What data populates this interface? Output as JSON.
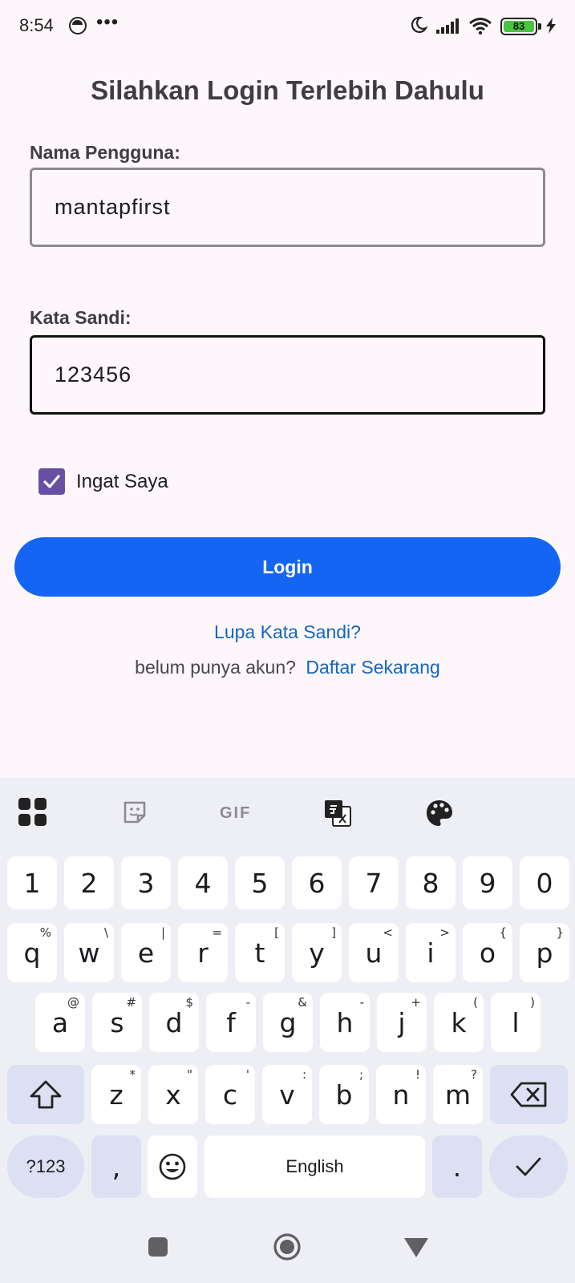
{
  "status_bar": {
    "time": "8:54",
    "more": "•••",
    "battery": "83"
  },
  "form": {
    "title": "Silahkan Login Terlebih Dahulu",
    "username_label": "Nama Pengguna:",
    "username_value": "mantapfirst",
    "password_label": "Kata Sandi:",
    "password_value": "123456",
    "remember_label": "Ingat Saya",
    "remember_checked": true,
    "login_label": "Login",
    "forgot_label": "Lupa Kata Sandi?",
    "register_prompt": "belum punya akun?",
    "register_link": "Daftar Sekarang",
    "accent_color": "#1565f4",
    "checkbox_color": "#6750a4"
  },
  "keyboard": {
    "toolbar": {
      "gif_label": "GIF"
    },
    "row_numbers": [
      "1",
      "2",
      "3",
      "4",
      "5",
      "6",
      "7",
      "8",
      "9",
      "0"
    ],
    "row1": [
      {
        "k": "q",
        "s": "%"
      },
      {
        "k": "w",
        "s": "\\"
      },
      {
        "k": "e",
        "s": "|"
      },
      {
        "k": "r",
        "s": "="
      },
      {
        "k": "t",
        "s": "["
      },
      {
        "k": "y",
        "s": "]"
      },
      {
        "k": "u",
        "s": "<"
      },
      {
        "k": "i",
        "s": ">"
      },
      {
        "k": "o",
        "s": "{"
      },
      {
        "k": "p",
        "s": "}"
      }
    ],
    "row2": [
      {
        "k": "a",
        "s": "@"
      },
      {
        "k": "s",
        "s": "#"
      },
      {
        "k": "d",
        "s": "$"
      },
      {
        "k": "f",
        "s": "-"
      },
      {
        "k": "g",
        "s": "&"
      },
      {
        "k": "h",
        "s": "-"
      },
      {
        "k": "j",
        "s": "+"
      },
      {
        "k": "k",
        "s": "("
      },
      {
        "k": "l",
        "s": ")"
      }
    ],
    "row3": [
      {
        "k": "z",
        "s": "*"
      },
      {
        "k": "x",
        "s": "\""
      },
      {
        "k": "c",
        "s": "'"
      },
      {
        "k": "v",
        "s": ":"
      },
      {
        "k": "b",
        "s": ";"
      },
      {
        "k": "n",
        "s": "!"
      },
      {
        "k": "m",
        "s": "?"
      }
    ],
    "symbols_label": "?123",
    "comma_label": ",",
    "space_label": "English",
    "period_label": "."
  }
}
